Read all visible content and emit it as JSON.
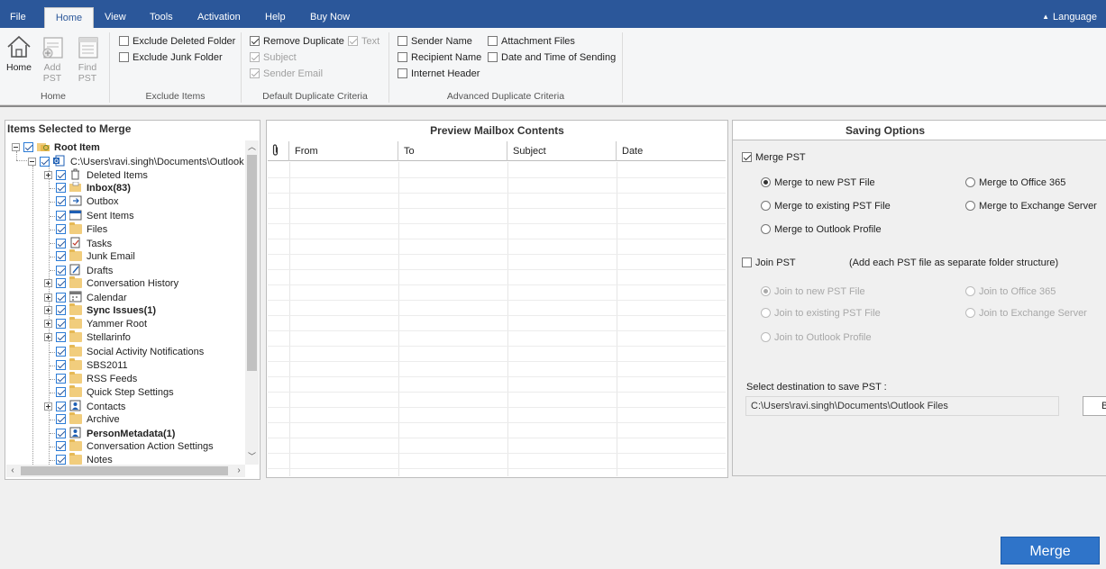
{
  "menu": {
    "items": [
      "File",
      "Home",
      "View",
      "Tools",
      "Activation",
      "Help",
      "Buy Now"
    ],
    "active": "Home",
    "language_label": "Language"
  },
  "ribbon": {
    "home_group": {
      "label": "Home",
      "buttons": [
        {
          "label": "Home",
          "enabled": true,
          "icon": "home-icon"
        },
        {
          "label": "Add\nPST",
          "enabled": false,
          "icon": "add-pst-icon"
        },
        {
          "label": "Find\nPST",
          "enabled": false,
          "icon": "find-pst-icon"
        }
      ]
    },
    "exclude_group": {
      "label": "Exclude Items",
      "options": [
        {
          "label": "Exclude Deleted Folder",
          "checked": false,
          "enabled": true
        },
        {
          "label": "Exclude Junk Folder",
          "checked": false,
          "enabled": true
        }
      ]
    },
    "duplicate_group": {
      "label": "Default Duplicate Criteria",
      "options": [
        {
          "label": "Remove Duplicate",
          "checked": true,
          "enabled": true
        },
        {
          "label": "Text",
          "checked": true,
          "enabled": false
        },
        {
          "label": "Subject",
          "checked": true,
          "enabled": false
        },
        {
          "label": "Sender Email",
          "checked": true,
          "enabled": false
        }
      ]
    },
    "advanced_group": {
      "label": "Advanced Duplicate Criteria",
      "options": [
        {
          "label": "Sender Name",
          "checked": false,
          "enabled": true
        },
        {
          "label": "Attachment Files",
          "checked": false,
          "enabled": true
        },
        {
          "label": "Recipient Name",
          "checked": false,
          "enabled": true
        },
        {
          "label": "Date and Time of Sending",
          "checked": false,
          "enabled": true
        },
        {
          "label": "Internet Header",
          "checked": false,
          "enabled": true
        }
      ]
    }
  },
  "left_panel": {
    "title": "Items Selected to Merge",
    "tree": [
      {
        "label": "Root Item",
        "level": 0,
        "bold": true,
        "expander": "minus",
        "icon": "root-folder-icon"
      },
      {
        "label": "C:\\Users\\ravi.singh\\Documents\\Outlook Fil",
        "level": 1,
        "bold": false,
        "expander": "minus",
        "icon": "outlook-pst-icon"
      },
      {
        "label": "Deleted Items",
        "level": 2,
        "bold": false,
        "expander": "plus",
        "icon": "trash-icon"
      },
      {
        "label": "Inbox(83)",
        "level": 2,
        "bold": true,
        "expander": "none",
        "icon": "inbox-icon"
      },
      {
        "label": "Outbox",
        "level": 2,
        "bold": false,
        "expander": "none",
        "icon": "outbox-icon"
      },
      {
        "label": "Sent Items",
        "level": 2,
        "bold": false,
        "expander": "none",
        "icon": "sent-icon"
      },
      {
        "label": "Files",
        "level": 2,
        "bold": false,
        "expander": "none",
        "icon": "folder-icon"
      },
      {
        "label": "Tasks",
        "level": 2,
        "bold": false,
        "expander": "none",
        "icon": "tasks-icon"
      },
      {
        "label": "Junk Email",
        "level": 2,
        "bold": false,
        "expander": "none",
        "icon": "folder-icon"
      },
      {
        "label": "Drafts",
        "level": 2,
        "bold": false,
        "expander": "none",
        "icon": "drafts-icon"
      },
      {
        "label": "Conversation History",
        "level": 2,
        "bold": false,
        "expander": "plus",
        "icon": "folder-icon"
      },
      {
        "label": "Calendar",
        "level": 2,
        "bold": false,
        "expander": "plus",
        "icon": "calendar-icon"
      },
      {
        "label": "Sync Issues(1)",
        "level": 2,
        "bold": true,
        "expander": "plus",
        "icon": "folder-icon"
      },
      {
        "label": "Yammer Root",
        "level": 2,
        "bold": false,
        "expander": "plus",
        "icon": "folder-icon"
      },
      {
        "label": "Stellarinfo",
        "level": 2,
        "bold": false,
        "expander": "plus",
        "icon": "folder-icon"
      },
      {
        "label": "Social Activity Notifications",
        "level": 2,
        "bold": false,
        "expander": "none",
        "icon": "folder-icon"
      },
      {
        "label": "SBS2011",
        "level": 2,
        "bold": false,
        "expander": "none",
        "icon": "folder-icon"
      },
      {
        "label": "RSS Feeds",
        "level": 2,
        "bold": false,
        "expander": "none",
        "icon": "folder-icon"
      },
      {
        "label": "Quick Step Settings",
        "level": 2,
        "bold": false,
        "expander": "none",
        "icon": "folder-icon"
      },
      {
        "label": "Contacts",
        "level": 2,
        "bold": false,
        "expander": "plus",
        "icon": "contacts-icon"
      },
      {
        "label": "Archive",
        "level": 2,
        "bold": false,
        "expander": "none",
        "icon": "folder-icon"
      },
      {
        "label": "PersonMetadata(1)",
        "level": 2,
        "bold": true,
        "expander": "none",
        "icon": "contacts-icon"
      },
      {
        "label": "Conversation Action Settings",
        "level": 2,
        "bold": false,
        "expander": "none",
        "icon": "folder-icon"
      },
      {
        "label": "Notes",
        "level": 2,
        "bold": false,
        "expander": "none",
        "icon": "folder-icon"
      }
    ]
  },
  "preview_panel": {
    "title": "Preview Mailbox Contents",
    "columns": [
      "From",
      "To",
      "Subject",
      "Date"
    ],
    "attachment_column_icon": "paperclip-icon"
  },
  "saving_options": {
    "title": "Saving Options",
    "merge_pst": {
      "label": "Merge PST",
      "checked": true
    },
    "merge_options": [
      {
        "label": "Merge to new PST File",
        "selected": true
      },
      {
        "label": "Merge to Office 365",
        "selected": false
      },
      {
        "label": "Merge to existing PST File",
        "selected": false
      },
      {
        "label": "Merge to Exchange Server",
        "selected": false
      },
      {
        "label": "Merge to Outlook Profile",
        "selected": false
      }
    ],
    "join_pst": {
      "label": "Join PST",
      "checked": false,
      "note": "(Add each PST file as separate folder structure)"
    },
    "join_options": [
      {
        "label": "Join to new PST File",
        "selected": true
      },
      {
        "label": "Join to Office 365",
        "selected": false
      },
      {
        "label": "Join to existing PST File",
        "selected": false
      },
      {
        "label": "Join to Exchange Server",
        "selected": false
      },
      {
        "label": "Join to Outlook Profile",
        "selected": false
      }
    ],
    "destination_label": "Select destination to save PST :",
    "destination_path": "C:\\Users\\ravi.singh\\Documents\\Outlook Files",
    "browse_label": "B"
  },
  "merge_button": "Merge",
  "colors": {
    "menu_bar": "#2b579a",
    "merge_button": "#2f74c9",
    "checkbox_blue": "#2b7bd6"
  }
}
